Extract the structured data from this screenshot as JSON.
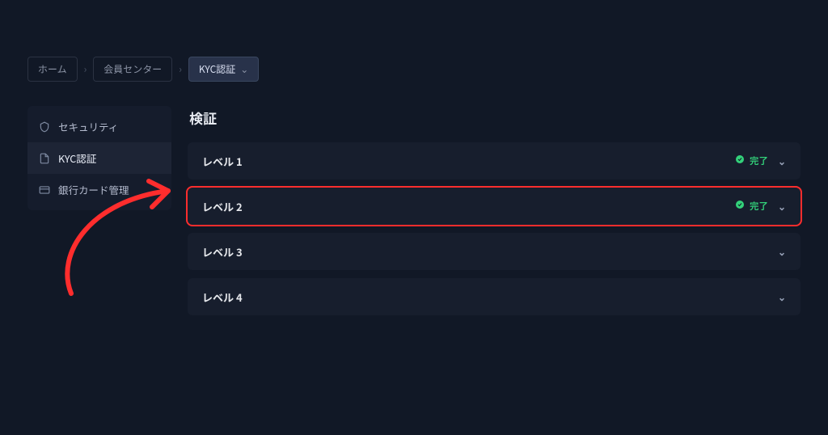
{
  "breadcrumb": {
    "home": "ホーム",
    "member": "会員センター",
    "current": "KYC認証"
  },
  "sidebar": {
    "items": [
      {
        "label": "セキュリティ"
      },
      {
        "label": "KYC認証"
      },
      {
        "label": "銀行カード管理"
      }
    ]
  },
  "page": {
    "title": "検証"
  },
  "levels": [
    {
      "label": "レベル 1",
      "status": "完了",
      "completed": true
    },
    {
      "label": "レベル 2",
      "status": "完了",
      "completed": true,
      "highlight": true
    },
    {
      "label": "レベル 3",
      "completed": false
    },
    {
      "label": "レベル 4",
      "completed": false
    }
  ]
}
